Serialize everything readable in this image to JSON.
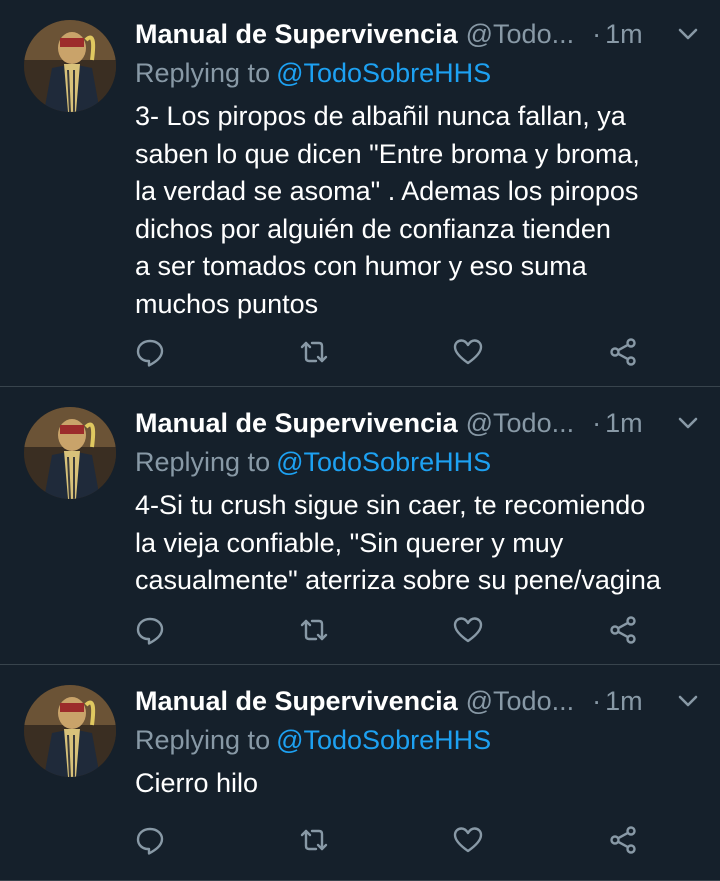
{
  "tweets": [
    {
      "name": "Manual de Supervivencia",
      "handle": "@Todo...",
      "dot": "·",
      "time": "1m",
      "reply_prefix": "Replying to",
      "reply_to": "@TodoSobreHHS",
      "text": "3- Los piropos de albañil nunca fallan, ya\nsaben lo que dicen \"Entre broma y broma,\nla verdad se asoma\" . Ademas los piropos\ndichos por alguién de confianza tienden\na ser tomados con humor y eso suma\nmuchos puntos"
    },
    {
      "name": "Manual de Supervivencia",
      "handle": "@Todo...",
      "dot": "·",
      "time": "1m",
      "reply_prefix": "Replying to",
      "reply_to": "@TodoSobreHHS",
      "text": "4-Si tu crush sigue sin caer, te recomiendo\nla vieja confiable, \"Sin querer y muy\ncasualmente\" aterriza sobre su pene/vagina"
    },
    {
      "name": "Manual de Supervivencia",
      "handle": "@Todo...",
      "dot": "·",
      "time": "1m",
      "reply_prefix": "Replying to",
      "reply_to": "@TodoSobreHHS",
      "text": "Cierro hilo"
    }
  ],
  "icons": {
    "reply": "reply-icon",
    "retweet": "retweet-icon",
    "like": "heart-icon",
    "share": "share-icon",
    "menu": "chevron-down-icon"
  },
  "colors": {
    "background": "#15202b",
    "secondary_text": "#8899a6",
    "link": "#1da1f2",
    "divider": "#38444d"
  }
}
